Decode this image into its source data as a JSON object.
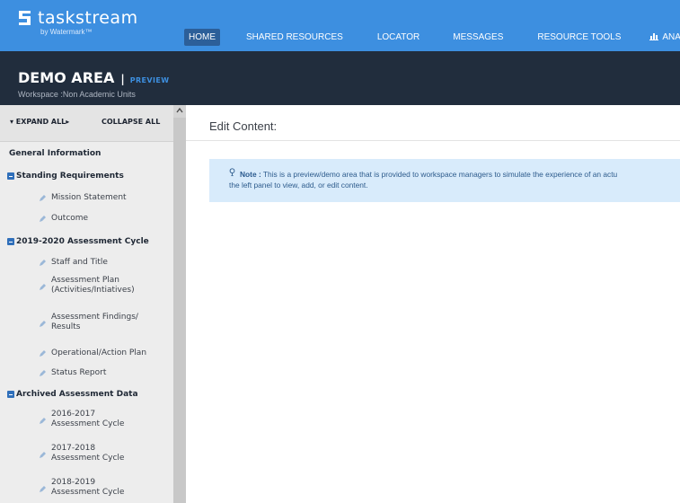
{
  "brand": {
    "name": "taskstream",
    "tagline": "by Watermark™"
  },
  "nav": {
    "items": [
      {
        "label": "HOME",
        "active": true
      },
      {
        "label": "SHARED RESOURCES"
      },
      {
        "label": "LOCATOR"
      },
      {
        "label": "MESSAGES"
      },
      {
        "label": "RESOURCE TOOLS"
      },
      {
        "label": "ANALYTICS",
        "icon": "bar-chart-icon"
      }
    ]
  },
  "header": {
    "title": "DEMO AREA",
    "separator": "|",
    "badge": "PREVIEW",
    "workspace": "Workspace :Non Academic Units"
  },
  "sidebar": {
    "expand_all": "▾ EXPAND ALL▸",
    "collapse_all": "COLLAPSE ALL",
    "general": "General Information",
    "sections": [
      {
        "label": "Standing Requirements",
        "items": [
          "Mission Statement",
          "Outcome"
        ]
      },
      {
        "label": "2019-2020 Assessment Cycle",
        "items": [
          "Staff and Title",
          "Assessment Plan (Activities/Intiatives)",
          "Assessment Findings/ Results",
          "Operational/Action Plan",
          "Status Report"
        ]
      },
      {
        "label": "Archived Assessment Data",
        "items": [
          "2016-2017 Assessment Cycle",
          "2017-2018 Assessment Cycle",
          "2018-2019 Assessment Cycle"
        ]
      }
    ]
  },
  "main": {
    "title": "Edit Content:",
    "note_label": "Note :",
    "note_line1": "This is a preview/demo area that is provided to workspace managers to simulate the experience of an actu",
    "note_line2": "the left panel to view, add, or edit content."
  },
  "colors": {
    "topbar": "#3d8fe0",
    "darkbar": "#212d3d",
    "accent": "#3d8fe0",
    "note_bg": "#d8ebfb"
  }
}
